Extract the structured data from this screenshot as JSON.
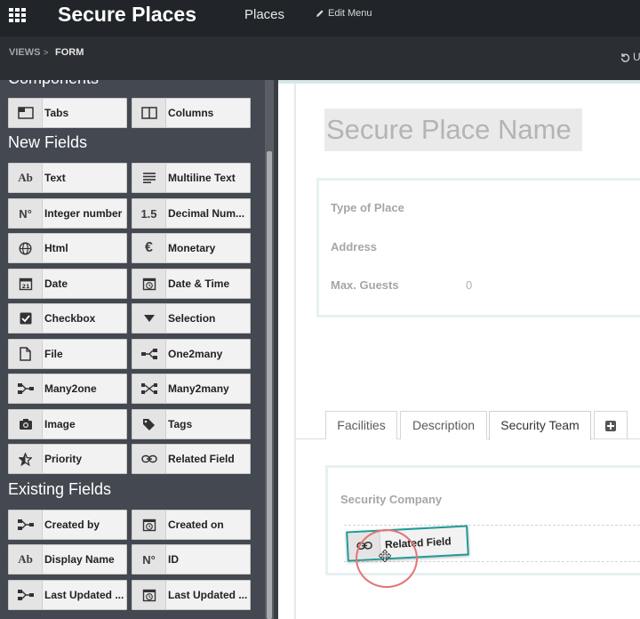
{
  "app": {
    "title": "Secure Places"
  },
  "nav": {
    "places": "Places",
    "edit_menu": "Edit Menu"
  },
  "breadcrumb": {
    "views": "VIEWS",
    "separator": ">",
    "form": "FORM"
  },
  "toolbar": {
    "undo_partial": "U"
  },
  "sidebar": {
    "components_title": "Components",
    "new_fields_title": "New Fields",
    "existing_fields_title": "Existing Fields",
    "components": [
      {
        "label": "Tabs",
        "icon": "tabs-icon"
      },
      {
        "label": "Columns",
        "icon": "columns-icon"
      }
    ],
    "new_fields": [
      {
        "label": "Text",
        "icon_text": "Ab"
      },
      {
        "label": "Multiline Text",
        "icon": "multiline-icon"
      },
      {
        "label": "Integer number",
        "icon_text": "N°"
      },
      {
        "label": "Decimal Num...",
        "icon_text": "1.5"
      },
      {
        "label": "Html",
        "icon": "globe-icon"
      },
      {
        "label": "Monetary",
        "icon_text": "€"
      },
      {
        "label": "Date",
        "icon": "calendar-icon",
        "icon_text": "21"
      },
      {
        "label": "Date & Time",
        "icon": "clock-calendar-icon"
      },
      {
        "label": "Checkbox",
        "icon": "checkbox-icon"
      },
      {
        "label": "Selection",
        "icon": "caret-down-icon"
      },
      {
        "label": "File",
        "icon": "file-icon"
      },
      {
        "label": "One2many",
        "icon": "one2many-icon"
      },
      {
        "label": "Many2one",
        "icon": "many2one-icon"
      },
      {
        "label": "Many2many",
        "icon": "many2many-icon"
      },
      {
        "label": "Image",
        "icon": "camera-icon"
      },
      {
        "label": "Tags",
        "icon": "tag-icon"
      },
      {
        "label": "Priority",
        "icon": "star-icon"
      },
      {
        "label": "Related Field",
        "icon": "link-icon"
      }
    ],
    "existing_fields": [
      {
        "label": "Created by",
        "icon": "many2one-icon"
      },
      {
        "label": "Created on",
        "icon": "clock-calendar-icon"
      },
      {
        "label": "Display Name",
        "icon_text": "Ab"
      },
      {
        "label": "ID",
        "icon_text": "N°"
      },
      {
        "label": "Last Updated ...",
        "icon": "many2one-icon"
      },
      {
        "label": "Last Updated ...",
        "icon": "clock-calendar-icon"
      }
    ]
  },
  "form": {
    "name_placeholder": "Secure Place Name",
    "fields": [
      {
        "label": "Type of Place",
        "value": ""
      },
      {
        "label": "Address",
        "value": ""
      },
      {
        "label": "Max. Guests",
        "value": "0"
      }
    ],
    "tabs": [
      "Facilities",
      "Description",
      "Security Team"
    ],
    "active_tab": "Security Team",
    "security_company_label": "Security Company"
  },
  "drag": {
    "label": "Related Field",
    "icon": "link-icon"
  },
  "colors": {
    "navbar": "#212529",
    "sidebar": "#444850",
    "accent_teal": "#1e9a94",
    "click_ring": "#e57373"
  }
}
